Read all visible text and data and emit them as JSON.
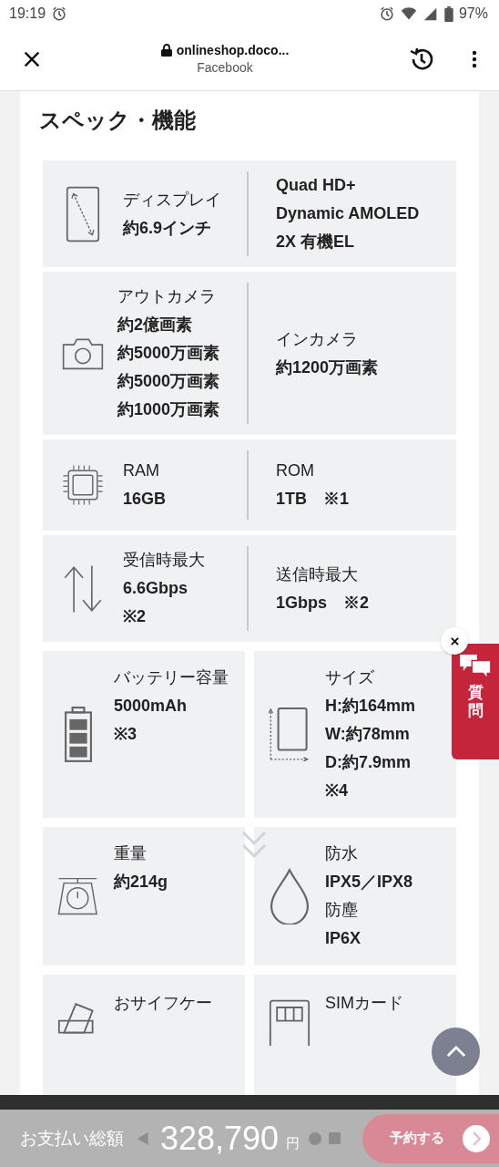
{
  "status_bar": {
    "time": "19:19",
    "battery": "97%"
  },
  "toolbar": {
    "url": "onlineshop.doco...",
    "subtitle": "Facebook"
  },
  "section": {
    "title": "スペック・機能"
  },
  "specs": [
    {
      "kind": "wide",
      "columns": [
        [
          {
            "text": "ディスプレイ",
            "bold": false
          },
          {
            "text": "約6.9インチ",
            "bold": true
          }
        ],
        [
          {
            "text": "Quad HD+ Dynamic AMOLED 2X 有機EL",
            "bold": true
          }
        ]
      ]
    },
    {
      "kind": "wide",
      "columns": [
        [
          {
            "text": "アウトカメラ",
            "bold": false
          },
          {
            "text": "約2億画素",
            "bold": true
          },
          {
            "text": "約5000万画素",
            "bold": true
          },
          {
            "text": "約5000万画素",
            "bold": true
          },
          {
            "text": "約1000万画素",
            "bold": true
          }
        ],
        [
          {
            "text": "インカメラ",
            "bold": false
          },
          {
            "text": "約1200万画素",
            "bold": true
          }
        ]
      ]
    },
    {
      "kind": "wide",
      "columns": [
        [
          {
            "text": "RAM",
            "bold": false
          },
          {
            "text": "16GB",
            "bold": true
          }
        ],
        [
          {
            "text": "ROM",
            "bold": false
          },
          {
            "text": "1TB　※1",
            "bold": true
          }
        ]
      ]
    },
    {
      "kind": "wide",
      "columns": [
        [
          {
            "text": "受信時最大",
            "bold": false
          },
          {
            "text": "6.6Gbps",
            "bold": true
          },
          {
            "text": "※2",
            "bold": true
          }
        ],
        [
          {
            "text": "送信時最大",
            "bold": false
          },
          {
            "text": "1Gbps　※2",
            "bold": true
          }
        ]
      ]
    },
    {
      "kind": "half",
      "lines": [
        {
          "text": "バッテリー容量",
          "bold": false
        },
        {
          "text": "5000mAh",
          "bold": true
        },
        {
          "text": "※3",
          "bold": true
        }
      ]
    },
    {
      "kind": "half",
      "lines": [
        {
          "text": "サイズ",
          "bold": false
        },
        {
          "text": "H:約164mm",
          "bold": true
        },
        {
          "text": "W:約78mm",
          "bold": true
        },
        {
          "text": "D:約7.9mm",
          "bold": true
        },
        {
          "text": "※4",
          "bold": true
        }
      ]
    },
    {
      "kind": "half",
      "lines": [
        {
          "text": "重量",
          "bold": false
        },
        {
          "text": "約214g",
          "bold": true
        }
      ]
    },
    {
      "kind": "half",
      "lines": [
        {
          "text": "防水",
          "bold": false
        },
        {
          "text": "IPX5／IPX8",
          "bold": true
        },
        {
          "text": "防塵",
          "bold": false
        },
        {
          "text": "IP6X",
          "bold": true
        }
      ]
    },
    {
      "kind": "half",
      "lines": [
        {
          "text": "おサイフケー",
          "bold": false
        }
      ]
    },
    {
      "kind": "half",
      "lines": [
        {
          "text": "SIMカード",
          "bold": false
        }
      ]
    }
  ],
  "question_tab": {
    "label": "質問"
  },
  "footer": {
    "label": "お支払い総額",
    "amount": "328,790",
    "unit": "円",
    "button": "予約する"
  }
}
